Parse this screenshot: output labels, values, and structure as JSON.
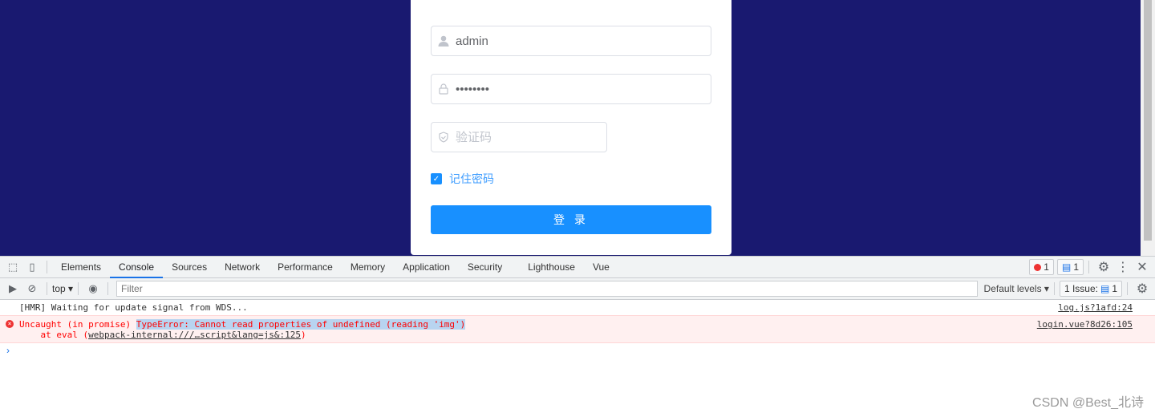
{
  "login": {
    "title": "",
    "username": "admin",
    "password": "••••••••",
    "captcha_placeholder": "验证码",
    "remember_label": "记住密码",
    "remember_checked": true,
    "login_button": "登 录"
  },
  "colors": {
    "page_bg": "#191970",
    "primary": "#1890ff",
    "error": "#ff0000"
  },
  "devtools": {
    "tabs": [
      "Elements",
      "Console",
      "Sources",
      "Network",
      "Performance",
      "Memory",
      "Application",
      "Security",
      "Lighthouse",
      "Vue"
    ],
    "active_tab": "Console",
    "error_count": "1",
    "message_count": "1",
    "context": "top",
    "filter_placeholder": "Filter",
    "levels": "Default levels",
    "issues_label": "1 Issue:",
    "issues_count": "1",
    "logs": [
      {
        "text": "[HMR] Waiting for update signal from WDS...",
        "source": "log.js?1afd:24"
      },
      {
        "prefix": "Uncaught (in promise) ",
        "highlight": "TypeError: Cannot read properties of undefined (reading 'img')",
        "line2_prefix": "    at eval (",
        "line2_link": "webpack-internal:///…script&lang=js&:125",
        "line2_suffix": ")",
        "source": "login.vue?8d26:105"
      }
    ],
    "prompt": "›"
  },
  "watermark": "CSDN @Best_北诗"
}
